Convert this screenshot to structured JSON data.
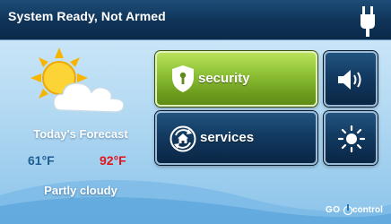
{
  "status": {
    "text": "System Ready, Not Armed",
    "icon": "power-plug-icon"
  },
  "weather": {
    "icon": "partly-cloudy-icon",
    "forecast_label": "Today's Forecast",
    "low_temp": "61°F",
    "high_temp": "92°F",
    "condition": "Partly cloudy",
    "low_color": "#1f5e91",
    "high_color": "#e0141a"
  },
  "buttons": {
    "security": {
      "label": "security",
      "icon": "shield-keyhole-icon",
      "accent": "#93c63a"
    },
    "services": {
      "label": "services",
      "icon": "home-refresh-icon"
    },
    "volume": {
      "icon": "speaker-volume-icon"
    },
    "brightness": {
      "icon": "brightness-sun-icon"
    }
  },
  "brand": {
    "go": "GO",
    "rest": "control"
  },
  "colors": {
    "topbar": "#0f3357",
    "background": "#b6dbf3",
    "button_dark": "#123a61"
  }
}
